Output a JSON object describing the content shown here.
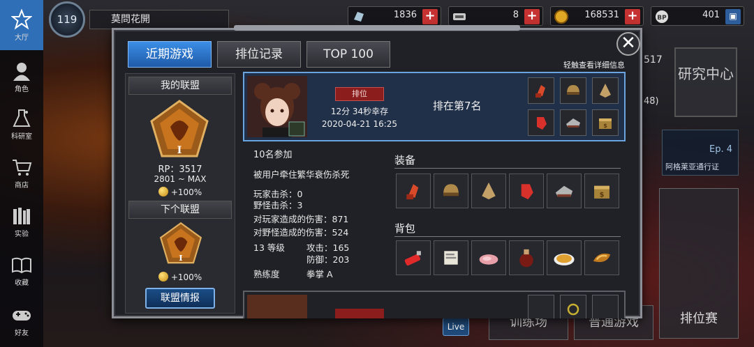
{
  "nav": [
    {
      "label": "大厅",
      "icon": "star-icon"
    },
    {
      "label": "角色",
      "icon": "character-icon"
    },
    {
      "label": "科研室",
      "icon": "flask-icon"
    },
    {
      "label": "商店",
      "icon": "cart-icon"
    },
    {
      "label": "实验",
      "icon": "books-icon"
    },
    {
      "label": "收藏",
      "icon": "open-book-icon"
    },
    {
      "label": "好友",
      "icon": "gamepad-icon"
    }
  ],
  "profile": {
    "level": "119",
    "name": "莫問花開"
  },
  "currencies": [
    {
      "icon": "crystal-icon",
      "value": "1836"
    },
    {
      "icon": "ticket-icon",
      "value": "8"
    },
    {
      "icon": "gold-coin-icon",
      "value": "168531"
    },
    {
      "icon": "bp-icon",
      "value": "401"
    }
  ],
  "tabs": [
    "近期游戏",
    "排位记录",
    "TOP 100"
  ],
  "hint": "轻触查看详细信息",
  "league": {
    "my_title": "我的联盟",
    "rp": "RP：3517",
    "range": "2801 ~ MAX",
    "bonus": "+100%",
    "badge_tier": "I",
    "next_title": "下个联盟",
    "next_tier": "I",
    "next_bonus": "+100%",
    "info_button": "联盟情报"
  },
  "match": {
    "mode": "排位",
    "survive": "12分 34秒幸存",
    "date": "2020-04-21 16:25",
    "placement": "排在第7名",
    "participants": "10名参加",
    "killed_by": "被用户牵住繁华衰伤杀死",
    "player_kills": "玩家击杀：0",
    "monster_kills": "野怪击杀：3",
    "player_damage": "对玩家造成的伤害：871",
    "monster_damage": "对野怪造成的伤害：524",
    "level": "13 等级",
    "attack": "攻击：165",
    "defense": "防御：203",
    "mastery_label": "熟练度",
    "mastery_value": "拳掌 A",
    "equip_title": "装备",
    "bag_title": "背包",
    "equipment_icons": [
      "gauntlet-icon",
      "helmet-icon",
      "armor-icon",
      "glove-icon",
      "boot-icon",
      "box-icon"
    ],
    "bag_icons": [
      "lighter-icon",
      "paper-icon",
      "meat-icon",
      "potion-icon",
      "dish-icon",
      "fried-food-icon"
    ]
  },
  "right_panel": {
    "research": "研究中心",
    "pass_ep": "Ep. 4",
    "pass_label": "阿格莱亚通行证",
    "live": "Live",
    "training": "训练场",
    "normal": "普通游戏",
    "ranked": "排位赛",
    "peek1": "517",
    "peek2": "48)"
  }
}
